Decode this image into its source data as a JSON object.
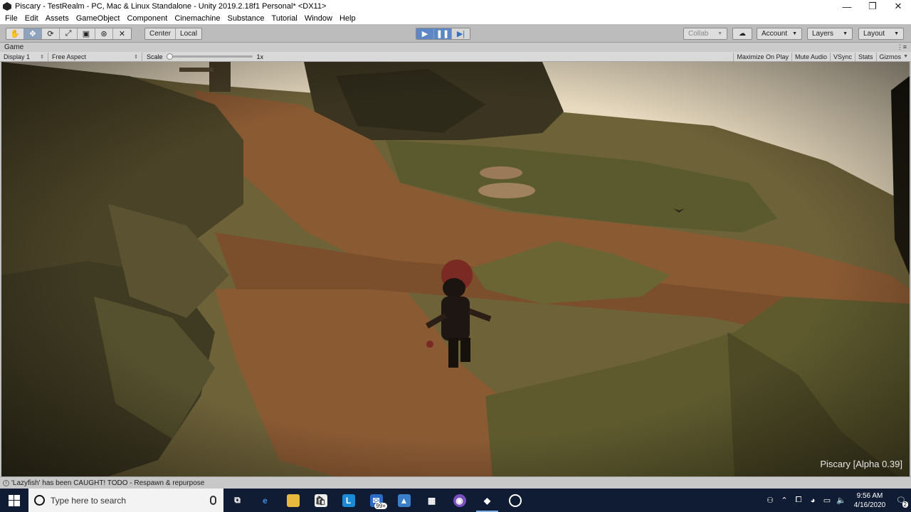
{
  "window": {
    "title": "Piscary - TestRealm - PC, Mac & Linux Standalone - Unity 2019.2.18f1 Personal* <DX11>",
    "controls": {
      "minimize": "—",
      "maximize": "❐",
      "close": "✕"
    }
  },
  "menu": [
    "File",
    "Edit",
    "Assets",
    "GameObject",
    "Component",
    "Cinemachine",
    "Substance",
    "Tutorial",
    "Window",
    "Help"
  ],
  "toolbar": {
    "tools": [
      {
        "icon": "hand-tool-icon",
        "glyph": "✋"
      },
      {
        "icon": "move-tool-icon",
        "glyph": "✥"
      },
      {
        "icon": "rotate-tool-icon",
        "glyph": "⟳"
      },
      {
        "icon": "scale-tool-icon",
        "glyph": "⤢"
      },
      {
        "icon": "rect-tool-icon",
        "glyph": "▣"
      },
      {
        "icon": "transform-tool-icon",
        "glyph": "⊛"
      },
      {
        "icon": "custom-tool-icon",
        "glyph": "✕"
      }
    ],
    "pivot": {
      "center": "Center",
      "local": "Local"
    },
    "play": {
      "play": "▶",
      "pause": "❚❚",
      "step": "▶|"
    },
    "collab": "Collab",
    "cloud": "☁",
    "account": "Account",
    "layers": "Layers",
    "layout": "Layout"
  },
  "game_tab": {
    "label": "Game",
    "menu": "⋮≡"
  },
  "game_bar": {
    "display": "Display 1",
    "aspect": "Free Aspect",
    "scale_label": "Scale",
    "scale_value": "1x",
    "toggles": [
      "Maximize On Play",
      "Mute Audio",
      "VSync",
      "Stats",
      "Gizmos"
    ]
  },
  "game_view": {
    "watermark": "Piscary [Alpha 0.39]"
  },
  "console": {
    "message": "'Lazyfish' has been CAUGHT! TODO - Respawn & repurpose"
  },
  "taskbar": {
    "search_placeholder": "Type here to search",
    "mail_badge": "99+",
    "clock_time": "9:56 AM",
    "clock_date": "4/16/2020",
    "notification_count": "2"
  },
  "colors": {
    "accent_play": "#5c86c6",
    "taskbar": "#0f1c33",
    "sky": "#e8dcc4",
    "path": "#8a5a33"
  }
}
